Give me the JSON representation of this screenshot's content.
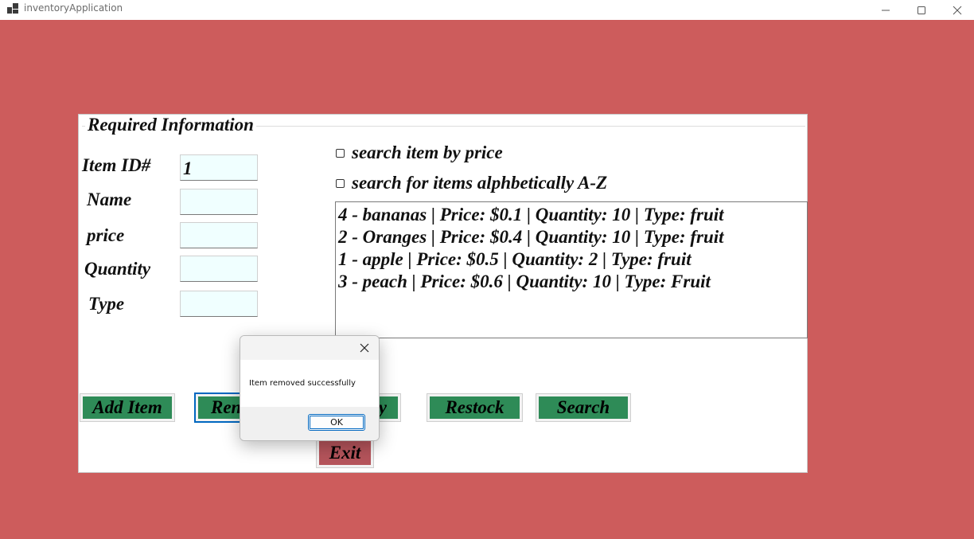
{
  "window": {
    "title": "inventoryApplication",
    "minimize_icon": "minimize-icon",
    "maximize_icon": "maximize-icon",
    "close_icon": "close-icon"
  },
  "form": {
    "group_title": "Required Information",
    "labels": {
      "item_id": "Item ID#",
      "name": "Name",
      "price": "price",
      "quantity": "Quantity",
      "type": "Type"
    },
    "values": {
      "item_id": "1",
      "name": "",
      "price": "",
      "quantity": "",
      "type": ""
    },
    "search_by_price_label": "search item by price",
    "search_alpha_label": "search for items alphbetically A-Z",
    "search_by_price_checked": false,
    "search_alpha_checked": false
  },
  "inventory_list": [
    "4 - bananas | Price: $0.1 | Quantity: 10 | Type: fruit",
    "2 - Oranges | Price: $0.4 | Quantity: 10 | Type: fruit",
    "1 - apple | Price: $0.5 | Quantity: 2 | Type: fruit",
    "3 - peach | Price: $0.6 | Quantity: 10 | Type: Fruit"
  ],
  "buttons": {
    "add_item": "Add Item",
    "remove_partial": "Ren",
    "hidden_partial": "y",
    "restock": "Restock",
    "search": "Search",
    "exit": "Exit"
  },
  "dialog": {
    "message": "Item removed successfully",
    "ok_label": "OK"
  },
  "colors": {
    "background": "#cd5c5c",
    "button_green": "#2e8b57",
    "exit_button": "#b5545b",
    "textbox_bg": "#f0ffff"
  }
}
